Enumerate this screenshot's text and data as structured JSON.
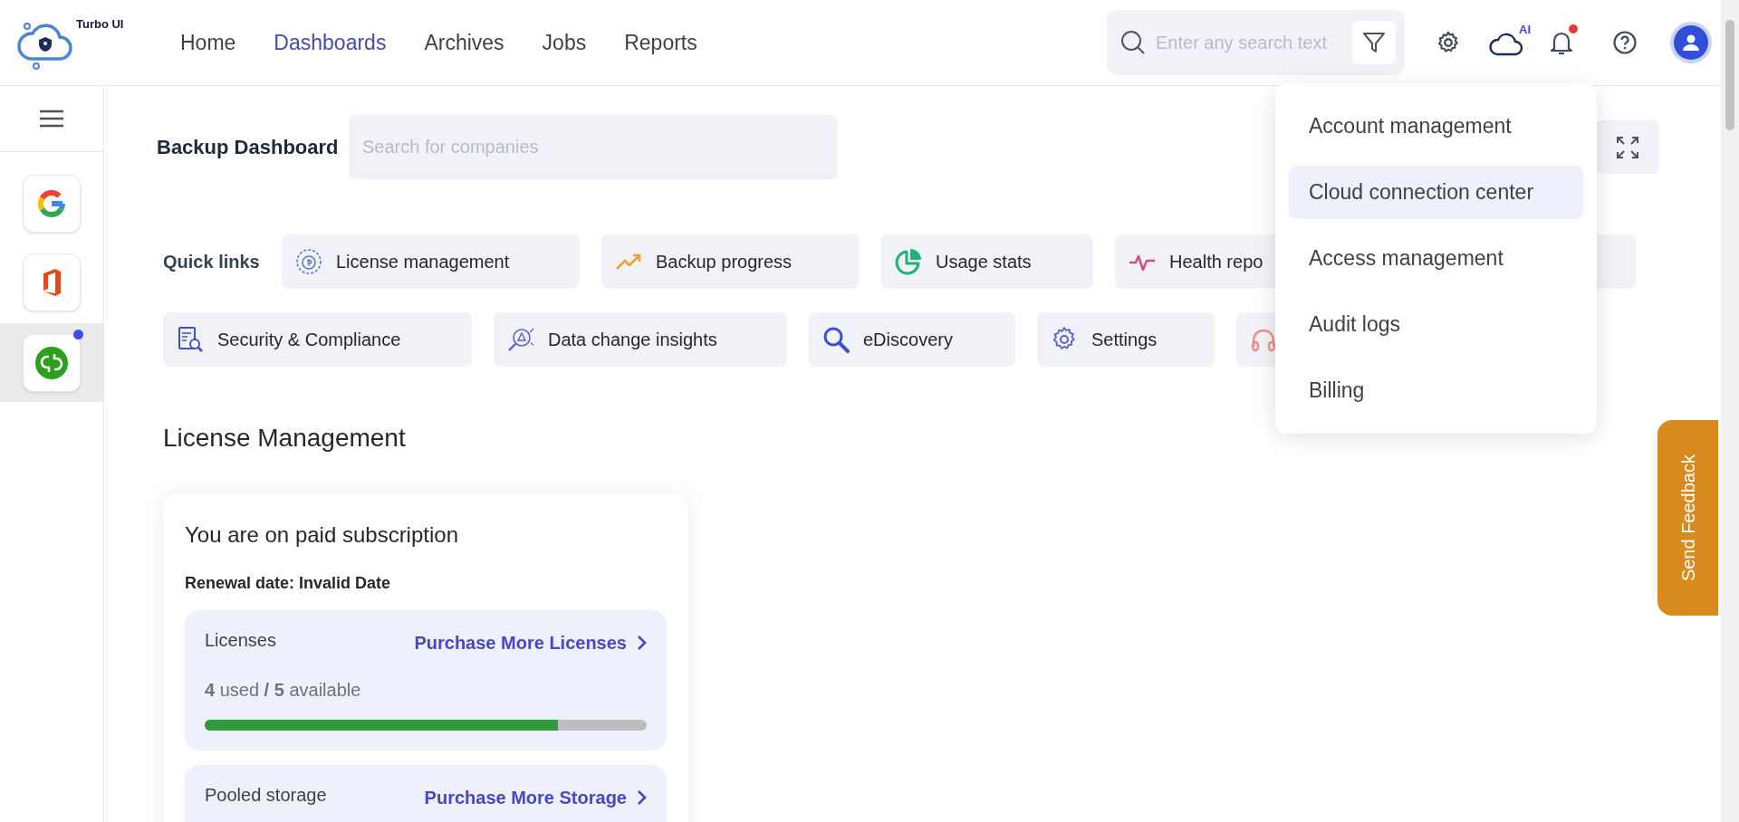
{
  "header": {
    "logo_text": "Turbo UI",
    "nav": [
      {
        "label": "Home",
        "selected": false
      },
      {
        "label": "Dashboards",
        "selected": true
      },
      {
        "label": "Archives",
        "selected": false
      },
      {
        "label": "Jobs",
        "selected": false
      },
      {
        "label": "Reports",
        "selected": false
      }
    ],
    "search": {
      "placeholder": "Enter any search text"
    },
    "cloud_badge": "AI",
    "has_notification": true
  },
  "sidebar": {
    "apps": [
      {
        "selected": false,
        "notification": false
      },
      {
        "selected": false,
        "notification": false
      },
      {
        "selected": true,
        "notification": true
      }
    ]
  },
  "dashboard": {
    "title": "Backup Dashboard",
    "search": {
      "placeholder": "Search for companies"
    }
  },
  "quick_links": {
    "label": "Quick links",
    "rows": [
      [
        {
          "kind": "labeled",
          "label": "License management"
        },
        {
          "kind": "labeled",
          "label": "Backup progress"
        },
        {
          "kind": "labeled",
          "label": "Usage stats"
        },
        {
          "kind": "labeled",
          "label": "Health repo"
        }
      ],
      [
        {
          "kind": "labeled",
          "label": "Security & Compliance"
        },
        {
          "kind": "labeled",
          "label": "Data change insights"
        },
        {
          "kind": "labeled",
          "label": "eDiscovery"
        },
        {
          "kind": "labeled",
          "label": "Settings"
        },
        {
          "kind": "icon_only"
        }
      ]
    ]
  },
  "license_section": {
    "title": "License Management",
    "card": {
      "title": "You are on paid subscription",
      "renewal": "Renewal date: Invalid Date",
      "boxes": [
        {
          "title": "Licenses",
          "link": "Purchase More Licenses",
          "usage": "**4** used **/ 5** available",
          "level": 0.8
        },
        {
          "title": "Pooled storage",
          "link": "Purchase More Storage"
        }
      ]
    }
  },
  "account_menu": {
    "items": [
      {
        "label": "Account management",
        "selected": false
      },
      {
        "label": "Cloud connection center",
        "selected": true
      },
      {
        "label": "Access management",
        "selected": false
      },
      {
        "label": "Audit logs",
        "selected": false
      },
      {
        "label": "Billing",
        "selected": false
      }
    ]
  },
  "feedback": {
    "label": "Send Feedback"
  }
}
